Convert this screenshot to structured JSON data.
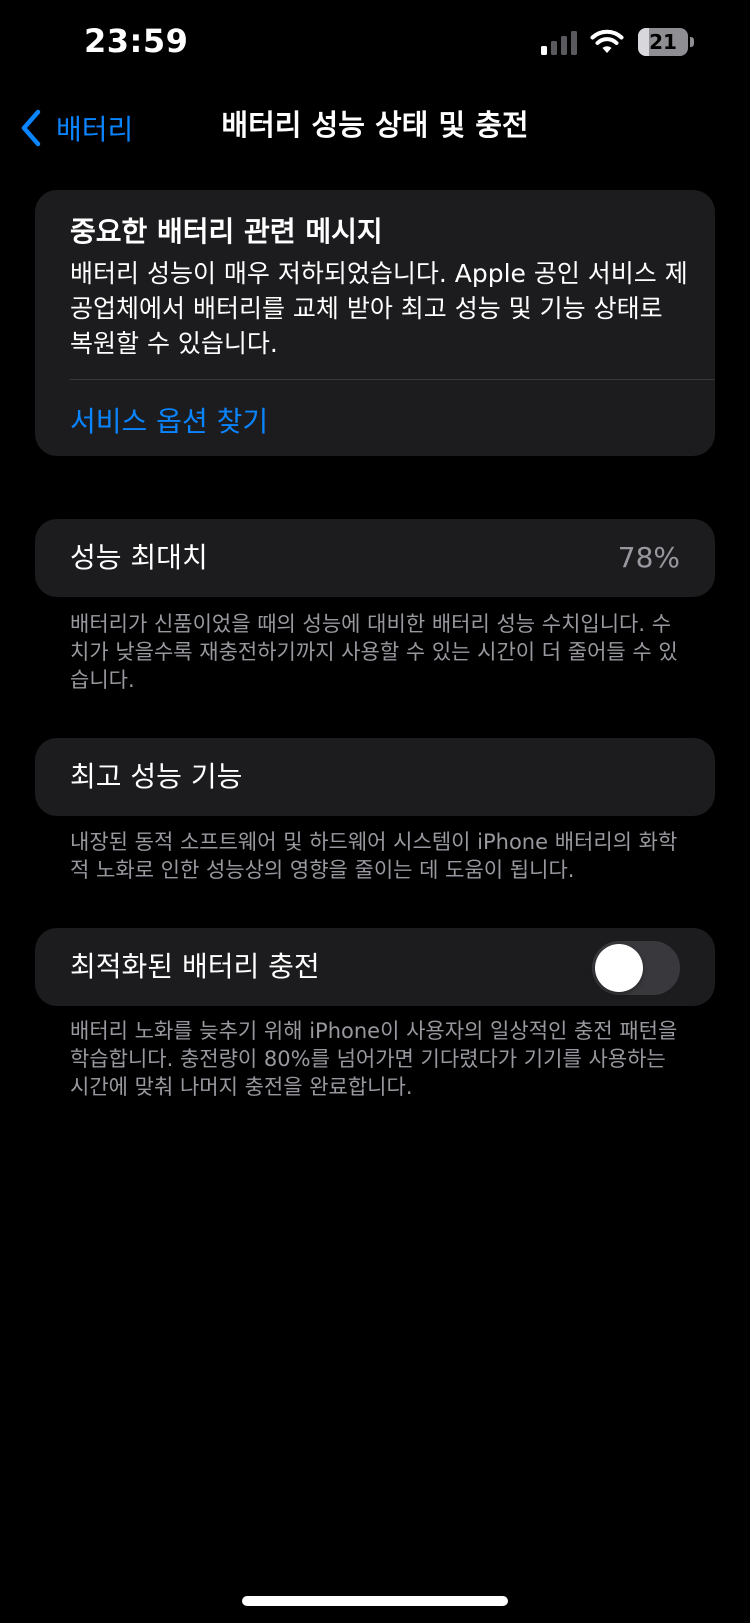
{
  "status_bar": {
    "time": "23:59",
    "battery_level": "21",
    "signal_icon": "cellular-signal-icon",
    "wifi_icon": "wifi-icon",
    "battery_icon": "battery-icon"
  },
  "nav": {
    "back_label": "배터리",
    "back_icon": "chevron-left-icon",
    "title": "배터리 성능 상태 및 충전"
  },
  "alert": {
    "title": "중요한 배터리 관련 메시지",
    "body": "배터리 성능이 매우 저하되었습니다. Apple 공인 서비스 제공업체에서 배터리를 교체 받아 최고 성능 및 기능 상태로 복원할 수 있습니다.",
    "link": "서비스 옵션 찾기"
  },
  "max_capacity": {
    "label": "성능 최대치",
    "value": "78%",
    "footnote": "배터리가 신품이었을 때의 성능에 대비한 배터리 성능 수치입니다. 수치가 낮을수록 재충전하기까지 사용할 수 있는 시간이 더 줄어들 수 있습니다."
  },
  "peak_performance": {
    "label": "최고 성능 기능",
    "footnote": "내장된 동적 소프트웨어 및 하드웨어 시스템이 iPhone 배터리의 화학적 노화로 인한 성능상의 영향을 줄이는 데 도움이 됩니다."
  },
  "optimized_charging": {
    "label": "최적화된 배터리 충전",
    "enabled": false,
    "footnote": "배터리 노화를 늦추기 위해 iPhone이 사용자의 일상적인 충전 패턴을 학습합니다. 충전량이 80%를 넘어가면 기다렸다가 기기를 사용하는 시간에 맞춰 나머지 충전을 완료합니다."
  },
  "colors": {
    "background": "#000000",
    "card": "#1c1c1e",
    "accent": "#0a84ff",
    "secondary_text": "#98989f",
    "toggle_off": "#39393d"
  }
}
